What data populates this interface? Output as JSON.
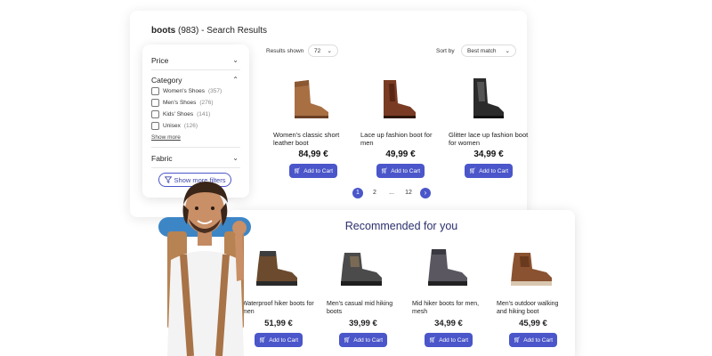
{
  "search": {
    "query": "boots",
    "count": "(983)",
    "suffix": "- Search Results"
  },
  "filters": {
    "price_label": "Price",
    "category_label": "Category",
    "categories": [
      {
        "label": "Women's Shoes",
        "count": "(357)"
      },
      {
        "label": "Men's Shoes",
        "count": "(276)"
      },
      {
        "label": "Kids' Shoes",
        "count": "(141)"
      },
      {
        "label": "Unisex",
        "count": "(126)"
      }
    ],
    "show_more": "Show more",
    "fabric_label": "Fabric",
    "more_filters": "Show more filters"
  },
  "toolbar": {
    "results_shown_label": "Results shown",
    "results_shown_value": "72",
    "sort_label": "Sort by",
    "sort_value": "Best match"
  },
  "products": [
    {
      "name": "Women's classic short leather boot",
      "price": "84,99 €",
      "cart": "Add to Cart"
    },
    {
      "name": "Lace up fashion boot for men",
      "price": "49,99 €",
      "cart": "Add to Cart"
    },
    {
      "name": "Glitter lace up fashion boot for women",
      "price": "34,99 €",
      "cart": "Add to Cart"
    }
  ],
  "pagination": {
    "pages": [
      "1",
      "2",
      "...",
      "12"
    ],
    "current": "1",
    "next_icon": "arrow-right-icon"
  },
  "recommended": {
    "title": "Recommended for you",
    "items": [
      {
        "name": "Waterproof hiker boots for men",
        "price": "51,99 €",
        "cart": "Add to Cart"
      },
      {
        "name": "Men's casual mid hiking boots",
        "price": "39,99 €",
        "cart": "Add to Cart"
      },
      {
        "name": "Mid hiker boots for men, mesh",
        "price": "34,99 €",
        "cart": "Add to Cart"
      },
      {
        "name": "Men's outdoor walking and hiking boot",
        "price": "45,99 €",
        "cart": "Add to Cart"
      }
    ]
  },
  "colors": {
    "accent": "#4a56c9",
    "recommended_title": "#2b2f6e"
  }
}
